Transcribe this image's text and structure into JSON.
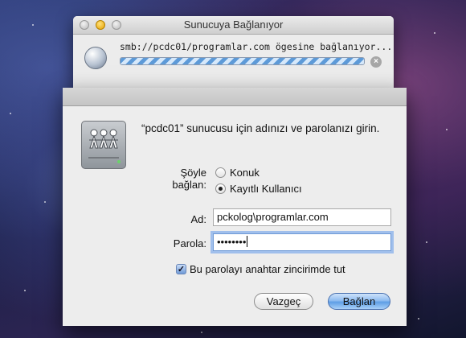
{
  "progress_window": {
    "title": "Sunucuya Bağlanıyor",
    "status": "smb://pcdc01/programlar.com ögesine bağlanıyor...",
    "progress": 1.0
  },
  "login": {
    "prompt": "“pcdc01” sunucusu için adınızı ve parolanızı girin.",
    "connect_as_label": "Şöyle bağlan:",
    "options": [
      {
        "label": "Konuk",
        "selected": false
      },
      {
        "label": "Kayıtlı Kullanıcı",
        "selected": true
      }
    ],
    "name_label": "Ad:",
    "name_value": "pckolog\\programlar.com",
    "password_label": "Parola:",
    "password_value": "••••••••",
    "remember_label": "Bu parolayı anahtar zincirimde tut",
    "remember_checked": true,
    "cancel_label": "Vazgeç",
    "connect_label": "Bağlan"
  },
  "icons": {
    "globe": "network-globe-icon",
    "server": "shared-server-icon",
    "cancel": "cancel-x-icon"
  },
  "colors": {
    "accent": "#5e9ee6",
    "focus_ring": "#6ca0eb"
  }
}
